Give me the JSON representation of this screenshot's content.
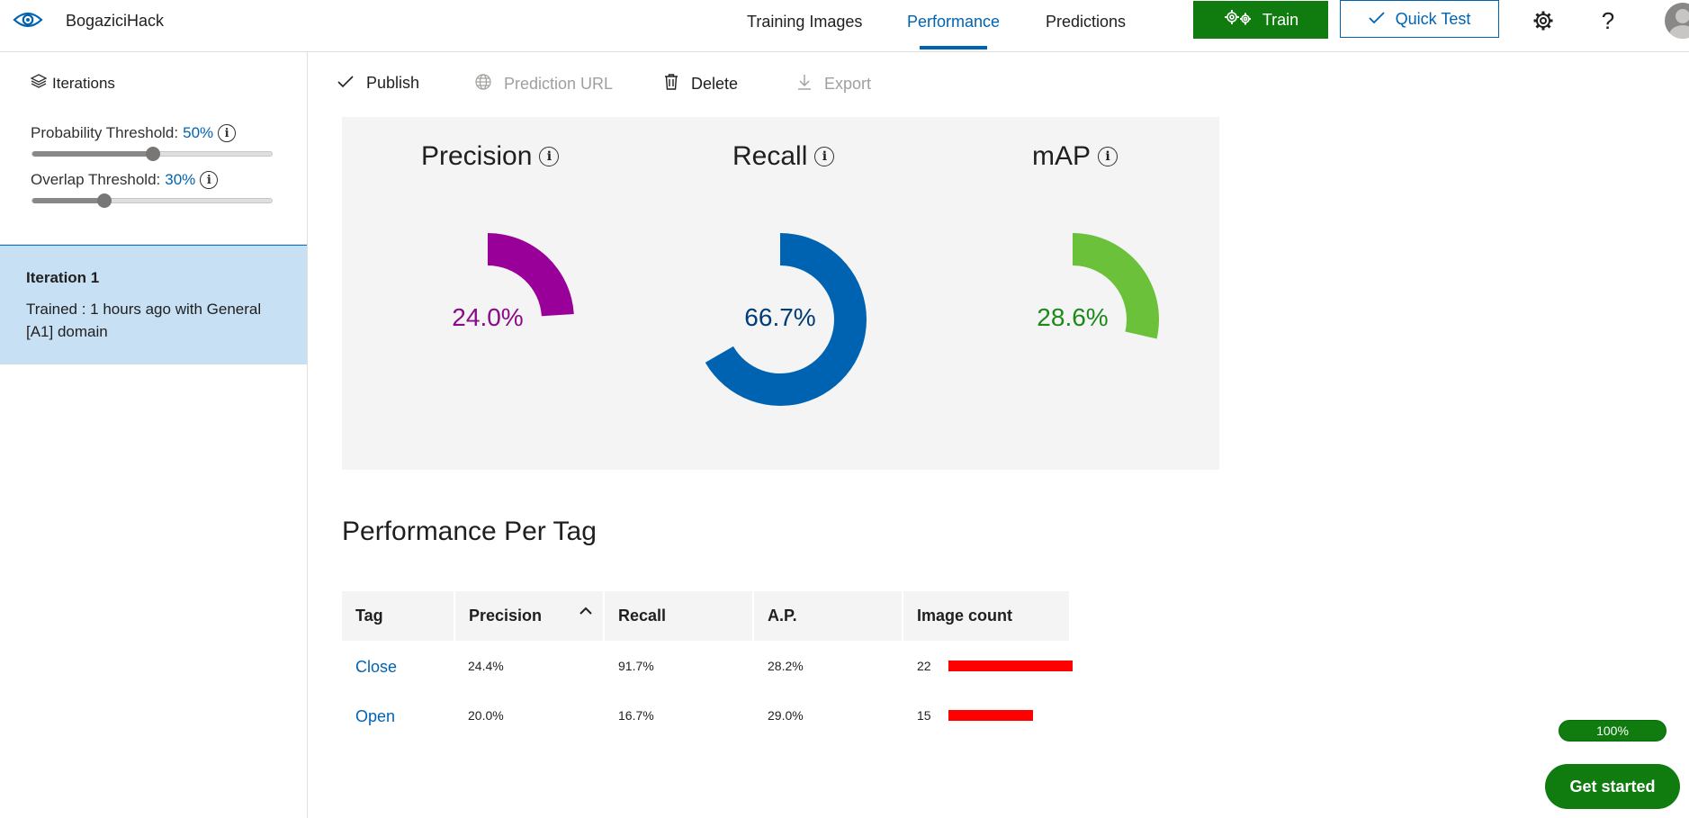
{
  "app": {
    "name": "BogaziciHack"
  },
  "nav": {
    "training_images": "Training Images",
    "performance": "Performance",
    "predictions": "Predictions"
  },
  "header": {
    "train_label": "Train",
    "quick_test_label": "Quick Test",
    "settings_icon": "gear-icon",
    "help_icon": "question-icon",
    "help_glyph": "?"
  },
  "sidebar": {
    "iterations_label": "Iterations",
    "probability_threshold": {
      "label": "Probability Threshold:",
      "value": "50%",
      "level": 0.5
    },
    "overlap_threshold": {
      "label": "Overlap Threshold:",
      "value": "30%",
      "level": 0.3
    },
    "iteration": {
      "title": "Iteration 1",
      "description": "Trained : 1 hours ago with General [A1] domain"
    }
  },
  "toolbar": {
    "publish": "Publish",
    "prediction_url": "Prediction URL",
    "delete": "Delete",
    "export": "Export"
  },
  "metrics": [
    {
      "title": "Precision",
      "value": "24.0%",
      "fraction": 0.24,
      "color": "#990099",
      "value_color": "#8a0a8a"
    },
    {
      "title": "Recall",
      "value": "66.7%",
      "fraction": 0.667,
      "color": "#0063b1",
      "value_color": "#003c78"
    },
    {
      "title": "mAP",
      "value": "28.6%",
      "fraction": 0.286,
      "color": "#6bc13a",
      "value_color": "#1b8a1b"
    }
  ],
  "per_tag": {
    "title": "Performance Per Tag",
    "headers": {
      "tag": "Tag",
      "precision": "Precision",
      "recall": "Recall",
      "ap": "A.P.",
      "image_count": "Image count"
    },
    "rows": [
      {
        "tag": "Close",
        "precision": "24.4%",
        "recall": "91.7%",
        "ap": "28.2%",
        "image_count": "22",
        "count_value": 22
      },
      {
        "tag": "Open",
        "precision": "20.0%",
        "recall": "16.7%",
        "ap": "29.0%",
        "image_count": "15",
        "count_value": 15
      }
    ],
    "bar_color": "#ff0000"
  },
  "progress": {
    "label": "100%"
  },
  "get_started": {
    "label": "Get started"
  }
}
